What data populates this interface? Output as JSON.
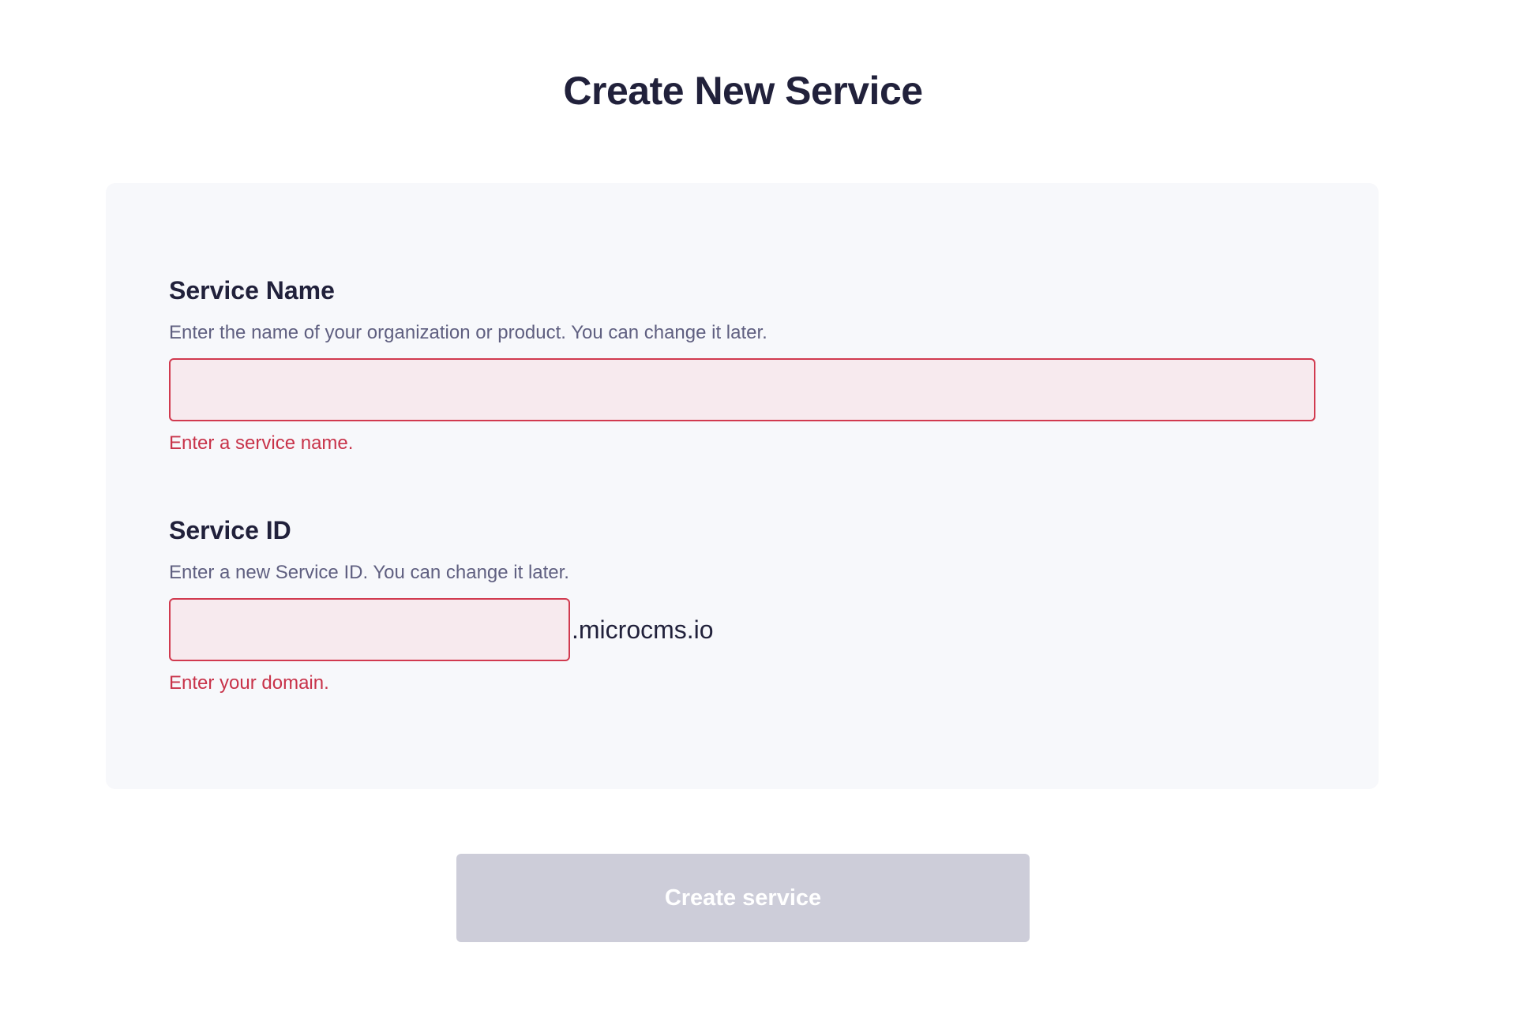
{
  "page": {
    "title": "Create New Service"
  },
  "form": {
    "service_name": {
      "label": "Service Name",
      "help": "Enter the name of your organization or product. You can change it later.",
      "value": "",
      "placeholder": "",
      "error": "Enter a service name."
    },
    "service_id": {
      "label": "Service ID",
      "help": "Enter a new Service ID. You can change it later.",
      "value": "",
      "placeholder": "",
      "suffix": ".microcms.io",
      "error": "Enter your domain."
    }
  },
  "actions": {
    "submit_label": "Create service",
    "submit_disabled": true
  },
  "colors": {
    "title_text": "#21213b",
    "card_background": "#f7f8fb",
    "error_border": "#d13a4f",
    "error_fill": "#f7eaee",
    "error_text": "#c8334a",
    "help_text": "#5f5f80",
    "button_disabled": "#cdcdd9"
  }
}
